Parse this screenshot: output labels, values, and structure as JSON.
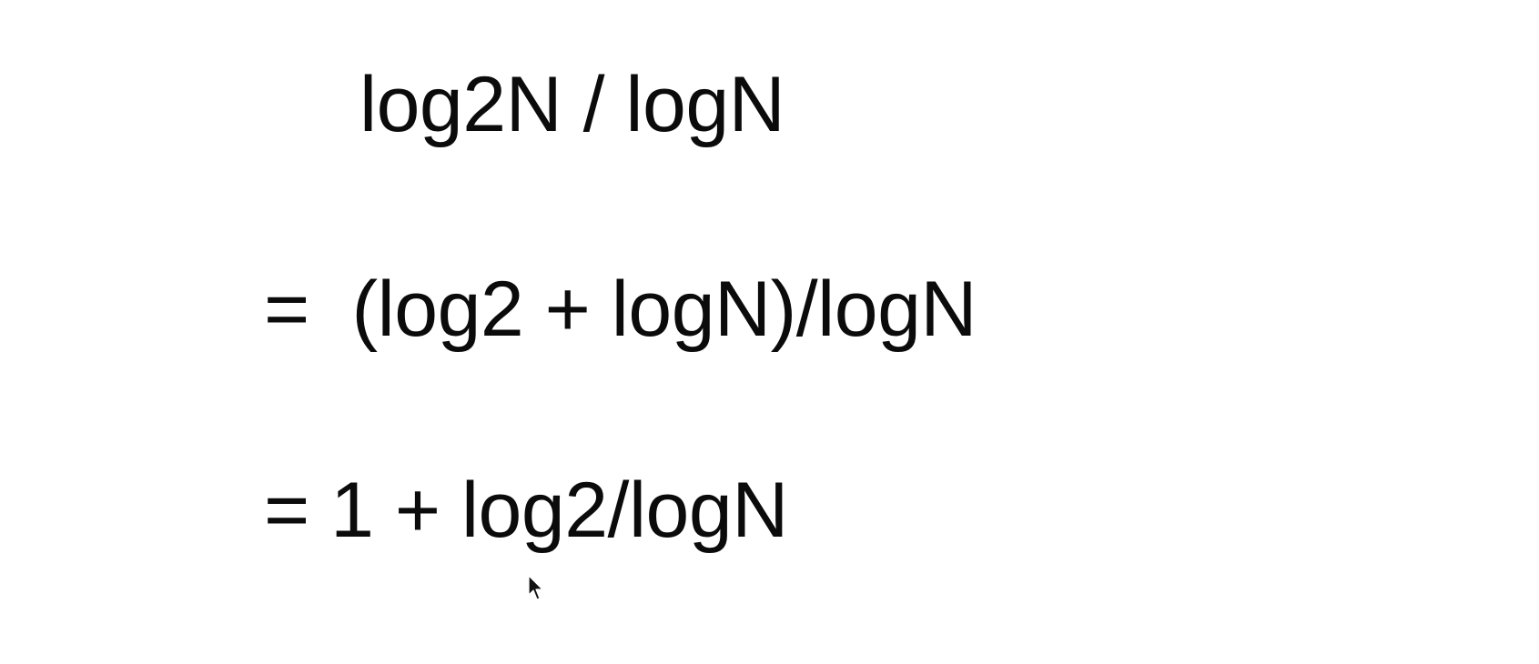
{
  "slide": {
    "lines": [
      "log2N / logN",
      "=  (log2 + logN)/logN",
      "= 1 + log2/logN"
    ]
  },
  "colors": {
    "background": "#ffffff",
    "text": "#0b0b0b"
  },
  "icons": {
    "pointer": "mouse-pointer-icon"
  }
}
